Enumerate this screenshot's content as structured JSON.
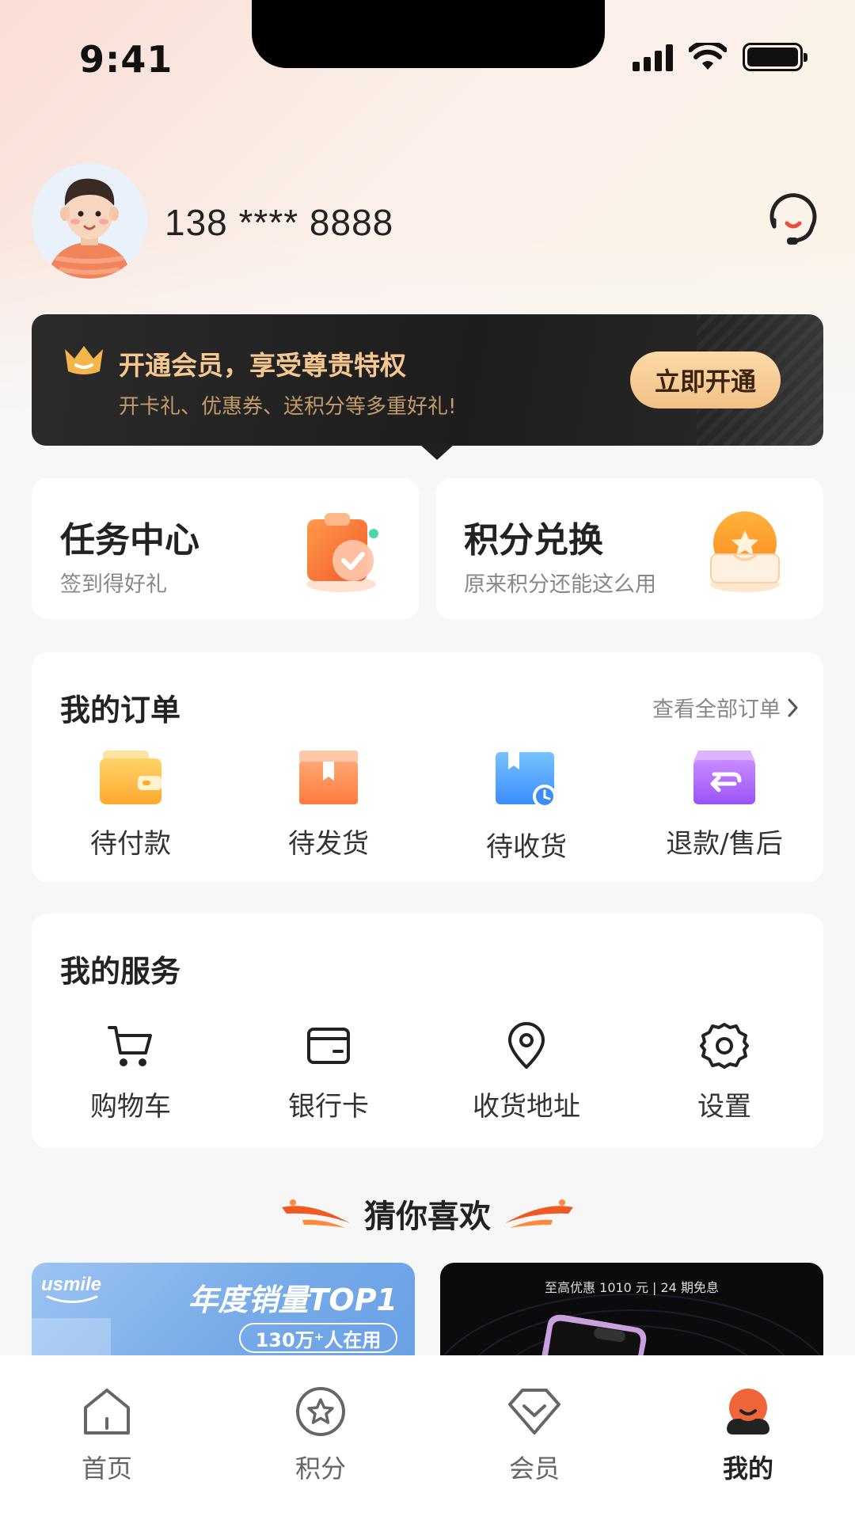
{
  "status_bar": {
    "time": "9:41"
  },
  "profile": {
    "phone": "138 **** 8888"
  },
  "member_banner": {
    "title": "开通会员，享受尊贵特权",
    "subtitle": "开卡礼、优惠券、送积分等多重好礼!",
    "button": "立即开通"
  },
  "features": [
    {
      "title": "任务中心",
      "subtitle": "签到得好礼"
    },
    {
      "title": "积分兑换",
      "subtitle": "原来积分还能这么用"
    }
  ],
  "orders": {
    "title": "我的订单",
    "view_all": "查看全部订单",
    "items": [
      {
        "label": "待付款",
        "icon": "wallet-icon"
      },
      {
        "label": "待发货",
        "icon": "box-icon"
      },
      {
        "label": "待收货",
        "icon": "delivery-box-icon"
      },
      {
        "label": "退款/售后",
        "icon": "refund-box-icon"
      }
    ]
  },
  "services": {
    "title": "我的服务",
    "items": [
      {
        "label": "购物车",
        "icon": "cart-icon"
      },
      {
        "label": "银行卡",
        "icon": "card-icon"
      },
      {
        "label": "收货地址",
        "icon": "location-icon"
      },
      {
        "label": "设置",
        "icon": "gear-icon"
      }
    ]
  },
  "recommend": {
    "title": "猜你喜欢",
    "products": [
      {
        "brand": "usmile",
        "headline": "年度销量TOP1",
        "badge": "130万⁺人在用"
      },
      {
        "promo": "至高优惠 1010 元 | 24 期免息"
      }
    ]
  },
  "tab_bar": {
    "active": 3,
    "tabs": [
      {
        "label": "首页",
        "icon": "home-icon"
      },
      {
        "label": "积分",
        "icon": "star-icon"
      },
      {
        "label": "会员",
        "icon": "diamond-icon"
      },
      {
        "label": "我的",
        "icon": "profile-icon"
      }
    ]
  },
  "colors": {
    "accent": "#f06a2a",
    "gold": "#f6c88f",
    "banner_dark": "#1d1d1d"
  }
}
